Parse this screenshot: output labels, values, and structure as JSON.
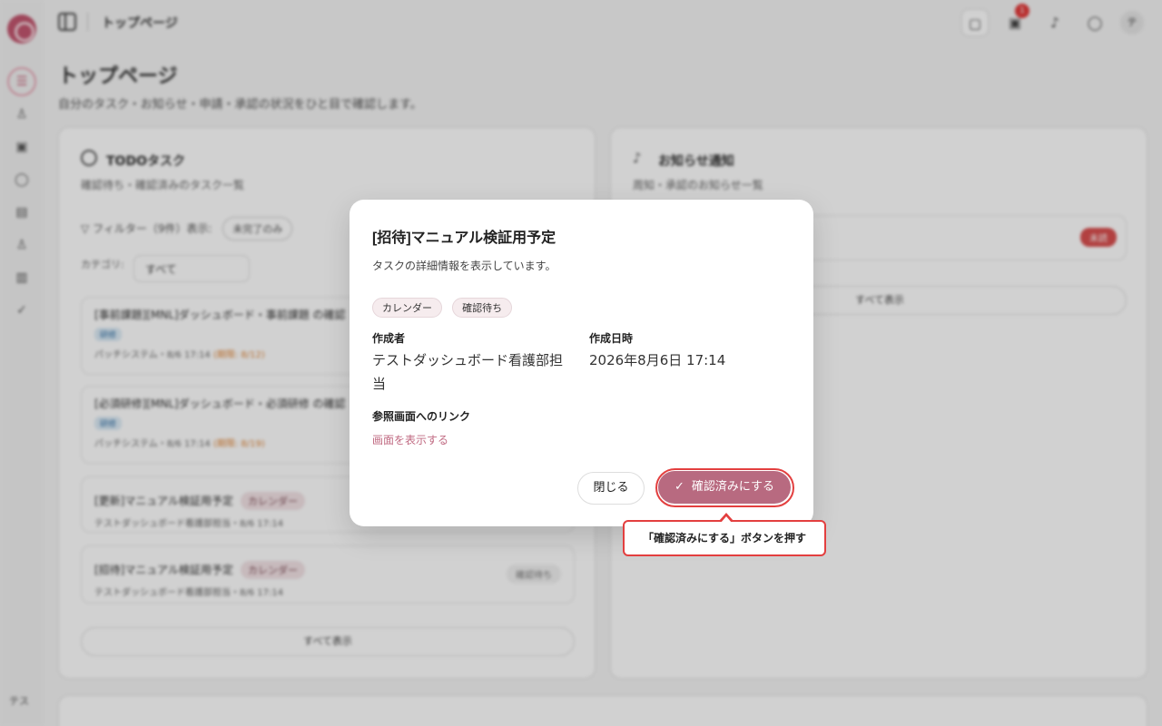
{
  "app": {
    "breadcrumb": "トップページ",
    "page_title": "トップページ",
    "page_subtitle": "自分のタスク・お知らせ・申請・承認の状況をひと目で確認します。",
    "rail_user_initials": "テス",
    "header_avatar_initial": "テ",
    "notification_count": "1"
  },
  "todo_panel": {
    "title": "TODOタスク",
    "subtitle": "確認待ち・確認済みのタスク一覧",
    "filter_label": "フィルター（9件）表示:",
    "filter_chip": "未完了のみ",
    "category_label": "カテゴリ:",
    "category_value": "すべて",
    "tasks": [
      {
        "title": "[事前課題][MNL]ダッシュボード・事前課題 の確認",
        "tag": "研修",
        "meta": "パッチシステム・8/6 17:14",
        "due": "(期限: 8/12)"
      },
      {
        "title": "[必須研修][MNL]ダッシュボード・必須研修 の確認",
        "tag": "研修",
        "meta": "パッチシステム・8/6 17:14",
        "due": "(期限: 8/19)"
      },
      {
        "title": "[更新]マニュアル検証用予定",
        "tag": "カレンダー",
        "meta": "テストダッシュボード看護部担当・8/6 17:14"
      },
      {
        "title": "[招待]マニュアル検証用予定",
        "tag": "カレンダー",
        "meta": "テストダッシュボード看護部担当・8/6 17:14",
        "status": "確認待ち"
      }
    ],
    "show_all": "すべて表示"
  },
  "notice_panel": {
    "title": "お知らせ通知",
    "subtitle": "周知・承認のお知らせ一覧",
    "badge": "未読",
    "show_all": "すべて表示"
  },
  "modal": {
    "title": "[招待]マニュアル検証用予定",
    "description": "タスクの詳細情報を表示しています。",
    "badges": [
      "カレンダー",
      "確認待ち"
    ],
    "author_label": "作成者",
    "author_value": "テストダッシュボード看護部担当",
    "date_label": "作成日時",
    "date_value": "2026年8月6日 17:14",
    "link_label": "参照画面へのリンク",
    "link_text": "画面を表示する",
    "close_label": "閉じる",
    "confirm_label": "確認済みにする"
  },
  "tooltip": {
    "text": "「確認済みにする」ボタンを押す"
  },
  "colors": {
    "accent": "#b86a80",
    "highlight": "#e33f3f"
  }
}
